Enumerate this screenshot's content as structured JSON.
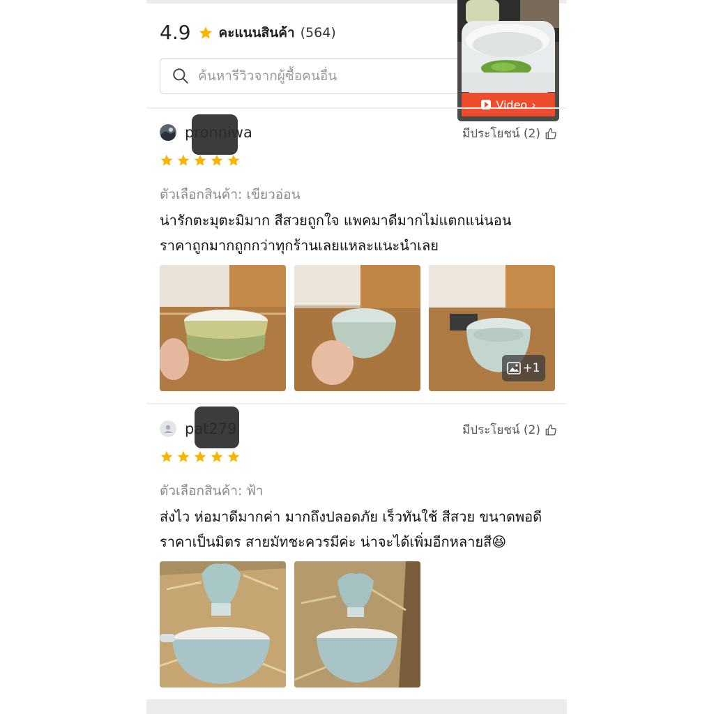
{
  "rating": {
    "score": "4.9",
    "label": "คะแนนสินค้า",
    "count": "(564)"
  },
  "search": {
    "placeholder": "ค้นหารีวิวจากผู้ซื้อคนอื่น"
  },
  "video": {
    "label": "Video"
  },
  "colors": {
    "accent": "#ee4d2d",
    "star": "#f7b500"
  },
  "reviews": [
    {
      "username": "pronniwa",
      "helpful": "มีประโยชน์ (2)",
      "stars": 5,
      "variant": "ตัวเลือกสินค้า: เขียวอ่อน",
      "comment_lines": [
        "น่ารักตะมุตะมิมาก สีสวยถูกใจ แพคมาดีมากไม่แตกแน่นอน",
        "ราคาถูกมากถูกกว่าทุกร้านเลยแหละแนะนำเลย"
      ],
      "more_photos": "+1"
    },
    {
      "username": "pat279",
      "helpful": "มีประโยชน์ (2)",
      "stars": 5,
      "variant": "ตัวเลือกสินค้า: ฟ้า",
      "comment_lines": [
        "ส่งไว ห่อมาดีมากค่า มากถึงปลอดภัย เร็วทันใช้ สีสวย ขนาดพอดี",
        "ราคาเป็นมิตร สายมัทชะควรมีค่ะ น่าจะได้เพิ่มอีกหลายสี😆"
      ]
    }
  ]
}
